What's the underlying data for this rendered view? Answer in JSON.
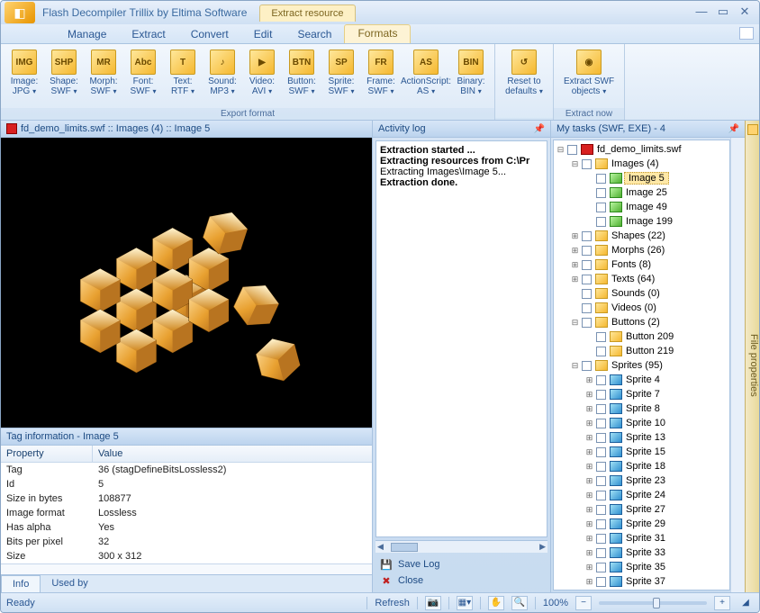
{
  "title": "Flash Decompiler Trillix by Eltima Software",
  "context_tab": "Extract resource",
  "menu": [
    "Manage",
    "Extract",
    "Convert",
    "Edit",
    "Search",
    "Formats"
  ],
  "menu_active": 5,
  "ribbon": {
    "groups": [
      {
        "label": "Export format",
        "items": [
          {
            "line1": "Image:",
            "line2": "JPG",
            "ico": "IMG"
          },
          {
            "line1": "Shape:",
            "line2": "SWF",
            "ico": "SHP"
          },
          {
            "line1": "Morph:",
            "line2": "SWF",
            "ico": "MR"
          },
          {
            "line1": "Font:",
            "line2": "SWF",
            "ico": "Abc"
          },
          {
            "line1": "Text:",
            "line2": "RTF",
            "ico": "T"
          },
          {
            "line1": "Sound:",
            "line2": "MP3",
            "ico": "♪"
          },
          {
            "line1": "Video:",
            "line2": "AVI",
            "ico": "▶"
          },
          {
            "line1": "Button:",
            "line2": "SWF",
            "ico": "BTN"
          },
          {
            "line1": "Sprite:",
            "line2": "SWF",
            "ico": "SP"
          },
          {
            "line1": "Frame:",
            "line2": "SWF",
            "ico": "FR"
          },
          {
            "line1": "ActionScript:",
            "line2": "AS",
            "ico": "AS",
            "wide": true
          },
          {
            "line1": "Binary:",
            "line2": "BIN",
            "ico": "BIN"
          }
        ]
      },
      {
        "label": "",
        "items": [
          {
            "line1": "Reset to",
            "line2": "defaults",
            "ico": "↺",
            "wide": true
          }
        ]
      },
      {
        "label": "Extract now",
        "items": [
          {
            "line1": "Extract SWF",
            "line2": "objects",
            "ico": "◉",
            "xwide": true
          }
        ]
      }
    ]
  },
  "preview_header": "fd_demo_limits.swf :: Images (4) :: Image 5",
  "taginfo_header": "Tag information - Image 5",
  "taginfo": {
    "col1": "Property",
    "col2": "Value",
    "rows": [
      [
        "Tag",
        "36 (stagDefineBitsLossless2)"
      ],
      [
        "Id",
        "5"
      ],
      [
        "Size in bytes",
        "108877"
      ],
      [
        "Image format",
        "Lossless"
      ],
      [
        "Has alpha",
        "Yes"
      ],
      [
        "Bits per pixel",
        "32"
      ],
      [
        "Size",
        "300 x 312"
      ]
    ]
  },
  "bottom_tabs": [
    "Info",
    "Used by"
  ],
  "activity": {
    "header": "Activity log",
    "lines": [
      {
        "t": "Extraction started ...",
        "b": true
      },
      {
        "t": "Extracting resources from C:\\Pr",
        "b": true
      },
      {
        "t": "Extracting Images\\Image 5...",
        "b": false
      },
      {
        "t": "Extraction done.",
        "b": true
      }
    ],
    "save": "Save Log",
    "close": "Close"
  },
  "tasks": {
    "header": "My tasks (SWF, EXE) - 4",
    "root": "fd_demo_limits.swf",
    "images": {
      "label": "Images (4)",
      "items": [
        "Image 5",
        "Image 25",
        "Image 49",
        "Image 199"
      ],
      "sel": 0
    },
    "groups": [
      "Shapes (22)",
      "Morphs (26)",
      "Fonts (8)",
      "Texts (64)",
      "Sounds (0)",
      "Videos (0)"
    ],
    "buttons": {
      "label": "Buttons (2)",
      "items": [
        "Button 209",
        "Button 219"
      ]
    },
    "sprites": {
      "label": "Sprites (95)",
      "items": [
        "Sprite 4",
        "Sprite 7",
        "Sprite 8",
        "Sprite 10",
        "Sprite 13",
        "Sprite 15",
        "Sprite 18",
        "Sprite 23",
        "Sprite 24",
        "Sprite 27",
        "Sprite 29",
        "Sprite 31",
        "Sprite 33",
        "Sprite 35",
        "Sprite 37"
      ]
    }
  },
  "side_tab": "File properties",
  "status": {
    "ready": "Ready",
    "refresh": "Refresh",
    "zoom": "100%"
  }
}
